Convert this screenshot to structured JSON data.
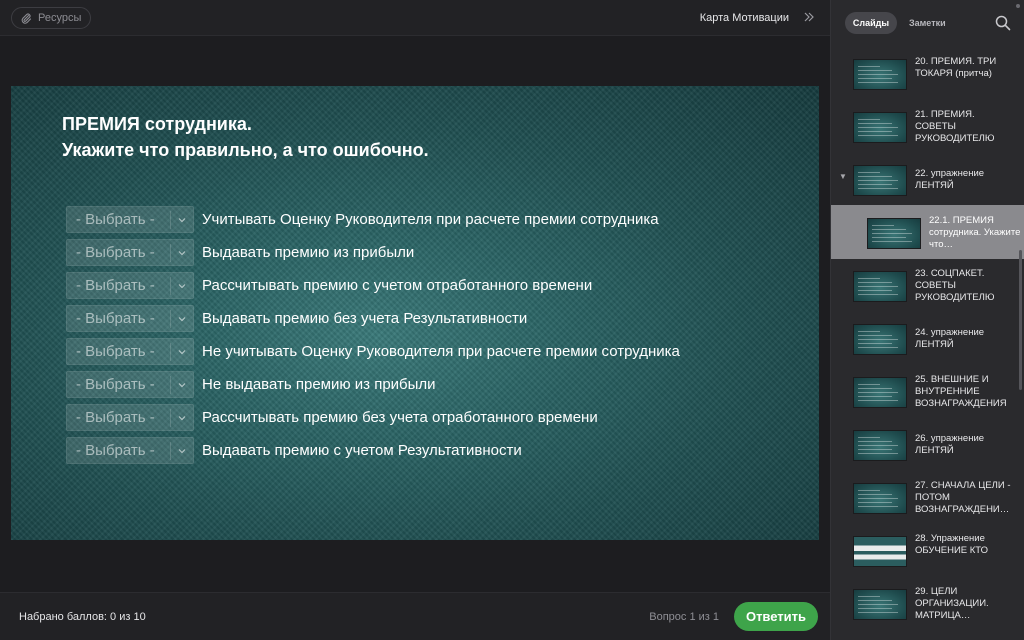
{
  "topbar": {
    "resources_label": "Ресурсы",
    "course_title": "Карта Мотивации"
  },
  "slide": {
    "title_line1": "ПРЕМИЯ сотрудника.",
    "title_line2": "Укажите что правильно, а что ошибочно.",
    "select_placeholder": "- Выбрать -",
    "statements": [
      "Учитывать Оценку Руководителя при расчете премии сотрудника",
      "Выдавать премию из прибыли",
      "Рассчитывать премию с учетом отработанного времени",
      "Выдавать премию без учета Результативности",
      "Не учитывать Оценку Руководителя при расчете премии сотрудника",
      "Не выдавать премию из прибыли",
      "Рассчитывать премию без учета отработанного времени",
      "Выдавать премию с учетом Результативности"
    ]
  },
  "bottombar": {
    "score": "Набрано баллов: 0 из 10",
    "question_counter": "Вопрос 1 из 1",
    "submit_label": "Ответить"
  },
  "sidebar": {
    "tab_slides": "Слайды",
    "tab_notes": "Заметки",
    "items": [
      "20. ПРЕМИЯ. ТРИ ТОКАРЯ (притча)",
      "21. ПРЕМИЯ. СОВЕТЫ РУКОВОДИТЕЛЮ",
      "22. упражнение ЛЕНТЯЙ",
      "22.1. ПРЕМИЯ сотрудника. Укажите что…",
      "23. СОЦПАКЕТ. СОВЕТЫ РУКОВОДИТЕЛЮ",
      "24. упражнение ЛЕНТЯЙ",
      "25. ВНЕШНИЕ И ВНУТРЕННИЕ ВОЗНАГРАЖДЕНИЯ",
      "26. упражнение ЛЕНТЯЙ",
      "27. СНАЧАЛА ЦЕЛИ - ПОТОМ ВОЗНАГРАЖДЕНИ…",
      "28. Упражнение ОБУЧЕНИЕ КТО",
      "29. ЦЕЛИ ОРГАНИЗАЦИИ. МАТРИЦА…"
    ]
  },
  "colors": {
    "accent_green": "#3ea44a",
    "slide_teal": "#2a6364",
    "active_item": "#8a8a8e"
  }
}
